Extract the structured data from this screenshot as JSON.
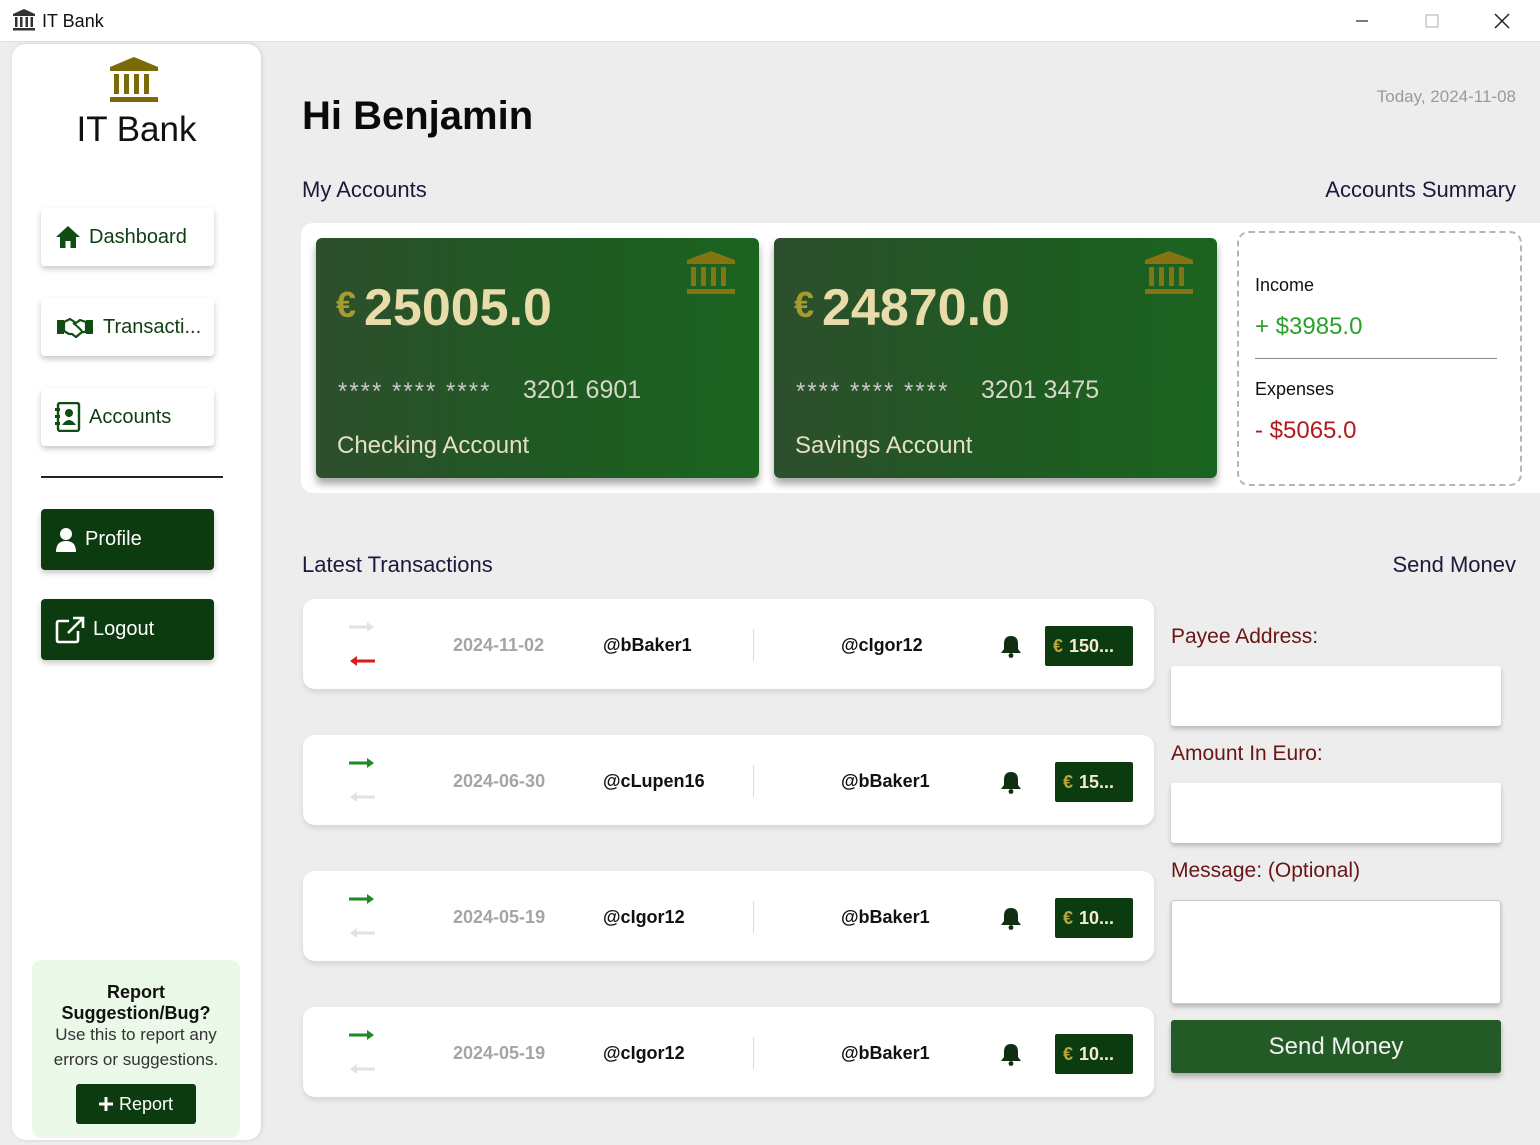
{
  "window": {
    "title": "IT Bank",
    "icon": "bank-icon",
    "controls": [
      "minimize",
      "maximize",
      "close"
    ]
  },
  "sidebar": {
    "logo_text": "IT Bank",
    "nav": [
      {
        "label": "Dashboard",
        "icon": "home-icon"
      },
      {
        "label": "Transacti...",
        "icon": "handshake-icon"
      },
      {
        "label": "Accounts",
        "icon": "contact-book-icon"
      }
    ],
    "profile_label": "Profile",
    "logout_label": "Logout",
    "report": {
      "title": "Report Suggestion/Bug?",
      "description": "Use this to report any errors or suggestions.",
      "button_label": "Report"
    }
  },
  "header": {
    "greeting": "Hi Benjamin",
    "today": "Today, 2024-11-08"
  },
  "accounts": {
    "section_title": "My Accounts",
    "summary_title": "Accounts Summary",
    "cards": [
      {
        "currency": "€",
        "balance": "25005.0",
        "masked": "**** **** ****",
        "number": "3201 6901",
        "type": "Checking Account"
      },
      {
        "currency": "€",
        "balance": "24870.0",
        "masked": "**** **** ****",
        "number": "3201 3475",
        "type": "Savings Account"
      }
    ],
    "summary": {
      "income_label": "Income",
      "income_value": "+ $3985.0",
      "expenses_label": "Expenses",
      "expenses_value": "- $5065.0"
    }
  },
  "transactions": {
    "section_title": "Latest Transactions",
    "items": [
      {
        "direction": "outgoing",
        "date": "2024-11-02",
        "from": "@bBaker1",
        "to": "@cIgor12",
        "currency": "€",
        "amount": "150..."
      },
      {
        "direction": "incoming",
        "date": "2024-06-30",
        "from": "@cLupen16",
        "to": "@bBaker1",
        "currency": "€",
        "amount": "15..."
      },
      {
        "direction": "incoming",
        "date": "2024-05-19",
        "from": "@cIgor12",
        "to": "@bBaker1",
        "currency": "€",
        "amount": "10..."
      },
      {
        "direction": "incoming",
        "date": "2024-05-19",
        "from": "@cIgor12",
        "to": "@bBaker1",
        "currency": "€",
        "amount": "10..."
      }
    ]
  },
  "send_money": {
    "section_title": "Send Monev",
    "payee_label": "Payee Address:",
    "payee_value": "",
    "amount_label": "Amount In Euro:",
    "amount_value": "",
    "message_label": "Message: (Optional)",
    "message_value": "",
    "button_label": "Send Money"
  },
  "colors": {
    "brand_dark": "#0c3b0f",
    "gold": "#7a6a0a",
    "income": "#2ca02c",
    "expense": "#b21a1a",
    "arrow_in": "#1e8a1e",
    "arrow_out": "#d81b1b"
  }
}
